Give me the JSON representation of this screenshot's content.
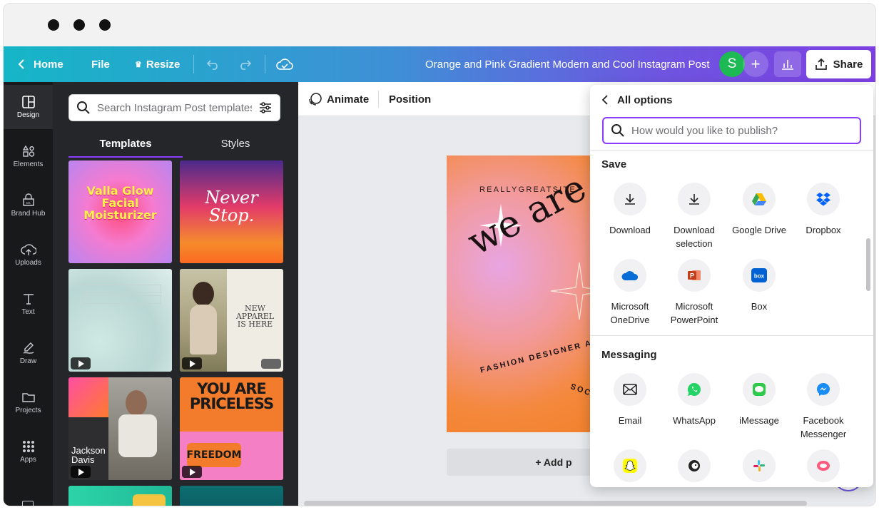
{
  "topbar": {
    "home_label": "Home",
    "file_label": "File",
    "resize_label": "Resize",
    "design_title": "Orange and Pink Gradient Modern and Cool Instagram Post",
    "avatar_initial": "S",
    "plus_label": "+",
    "share_label": "Share"
  },
  "rail": {
    "items": [
      {
        "label": "Design",
        "icon": "layout-icon"
      },
      {
        "label": "Elements",
        "icon": "shapes-icon"
      },
      {
        "label": "Brand Hub",
        "icon": "brand-icon"
      },
      {
        "label": "Uploads",
        "icon": "cloud-upload-icon"
      },
      {
        "label": "Text",
        "icon": "text-icon"
      },
      {
        "label": "Draw",
        "icon": "draw-icon"
      },
      {
        "label": "Projects",
        "icon": "folder-icon"
      },
      {
        "label": "Apps",
        "icon": "apps-grid-icon"
      }
    ]
  },
  "panel": {
    "search_placeholder": "Search Instagram Post templates",
    "tabs": [
      "Templates",
      "Styles"
    ],
    "templates": [
      {
        "name": "valla-glow",
        "lines": [
          "Valla Glow",
          "Facial",
          "Moisturizer"
        ]
      },
      {
        "name": "never-stop",
        "lines": [
          "Never",
          "Stop."
        ]
      },
      {
        "name": "bubbles",
        "lines": []
      },
      {
        "name": "new-apparel",
        "lines": [
          "NEW",
          "APPAREL",
          "IS HERE"
        ]
      },
      {
        "name": "jackson-davis",
        "lines": [
          "Jackson",
          "Davis"
        ]
      },
      {
        "name": "you-are-priceless",
        "lines": [
          "YOU ARE",
          "PRICELESS",
          "FREEDOM"
        ]
      }
    ]
  },
  "editor": {
    "animate_label": "Animate",
    "position_label": "Position",
    "canvas": {
      "brand": "REALLYGREATSITE",
      "headline": "we are",
      "curve_text": "FASHION DESIGNER AND",
      "curve_text_2": "SOC"
    },
    "add_page_label": "+ Add p"
  },
  "share_panel": {
    "back_label": "All options",
    "search_placeholder": "How would you like to publish?",
    "sections": [
      {
        "title": "Save",
        "options": [
          {
            "label": "Download",
            "icon": "download-icon"
          },
          {
            "label": "Download selection",
            "icon": "download-selection-icon"
          },
          {
            "label": "Google Drive",
            "icon": "google-drive-icon"
          },
          {
            "label": "Dropbox",
            "icon": "dropbox-icon"
          },
          {
            "label": "Microsoft OneDrive",
            "icon": "onedrive-icon"
          },
          {
            "label": "Microsoft PowerPoint",
            "icon": "powerpoint-icon"
          },
          {
            "label": "Box",
            "icon": "box-icon"
          }
        ]
      },
      {
        "title": "Messaging",
        "options": [
          {
            "label": "Email",
            "icon": "email-icon"
          },
          {
            "label": "WhatsApp",
            "icon": "whatsapp-icon"
          },
          {
            "label": "iMessage",
            "icon": "imessage-icon"
          },
          {
            "label": "Facebook Messenger",
            "icon": "messenger-icon"
          },
          {
            "label": "",
            "icon": "snapchat-icon"
          },
          {
            "label": "",
            "icon": "mailchimp-icon"
          },
          {
            "label": "",
            "icon": "slack-icon"
          },
          {
            "label": "",
            "icon": "other-app-icon"
          }
        ]
      }
    ]
  },
  "colors": {
    "accent": "#8b3dff",
    "avatar": "#1db954",
    "rail_bg": "#18191b",
    "panel_bg": "#25262a"
  }
}
